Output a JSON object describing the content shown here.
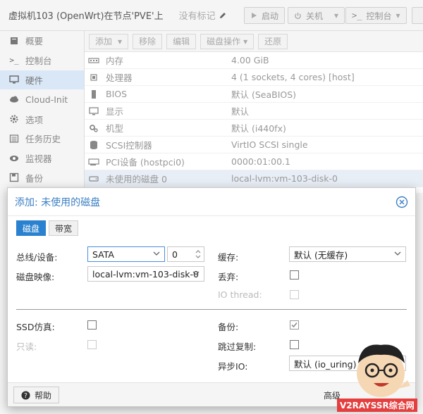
{
  "header": {
    "vm_title": "虚拟机103 (OpenWrt)在节点'PVE'上",
    "no_tag": "没有标记",
    "start": "启动",
    "shutdown": "关机",
    "console": "控制台"
  },
  "sidebar": {
    "items": [
      {
        "label": "概要",
        "icon": "book-icon"
      },
      {
        "label": "控制台",
        "icon": "terminal-icon"
      },
      {
        "label": "硬件",
        "icon": "monitor-icon"
      },
      {
        "label": "Cloud-Init",
        "icon": "cloud-icon"
      },
      {
        "label": "选项",
        "icon": "gear-icon"
      },
      {
        "label": "任务历史",
        "icon": "list-icon"
      },
      {
        "label": "监视器",
        "icon": "eye-icon"
      },
      {
        "label": "备份",
        "icon": "floppy-icon"
      }
    ]
  },
  "toolbar": {
    "add": "添加",
    "remove": "移除",
    "edit": "编辑",
    "disk_ops": "磁盘操作",
    "revert": "还原"
  },
  "hardware": [
    {
      "label": "内存",
      "value": "4.00 GiB"
    },
    {
      "label": "处理器",
      "value": "4 (1 sockets, 4 cores) [host]"
    },
    {
      "label": "BIOS",
      "value": "默认 (SeaBIOS)"
    },
    {
      "label": "显示",
      "value": "默认"
    },
    {
      "label": "机型",
      "value": "默认 (i440fx)"
    },
    {
      "label": "SCSI控制器",
      "value": "VirtIO SCSI single"
    },
    {
      "label": "PCI设备 (hostpci0)",
      "value": "0000:01:00.1"
    },
    {
      "label": "未使用的磁盘 0",
      "value": "local-lvm:vm-103-disk-0"
    }
  ],
  "dialog": {
    "title": "添加: 未使用的磁盘",
    "tabs": [
      "磁盘",
      "带宽"
    ],
    "bus_label": "总线/设备:",
    "bus_value": "SATA",
    "bus_index": "0",
    "image_label": "磁盘映像:",
    "image_value": "local-lvm:vm-103-disk-0",
    "cache_label": "缓存:",
    "cache_value": "默认 (无缓存)",
    "discard_label": "丢弃:",
    "iothread_label": "IO thread:",
    "ssd_label": "SSD仿真:",
    "readonly_label": "只读:",
    "backup_label": "备份:",
    "skip_repl_label": "跳过复制:",
    "async_label": "异步IO:",
    "async_value": "默认 (io_uring)",
    "help": "帮助",
    "advanced": "高级"
  },
  "watermark": "V2RAYSSR综合网"
}
